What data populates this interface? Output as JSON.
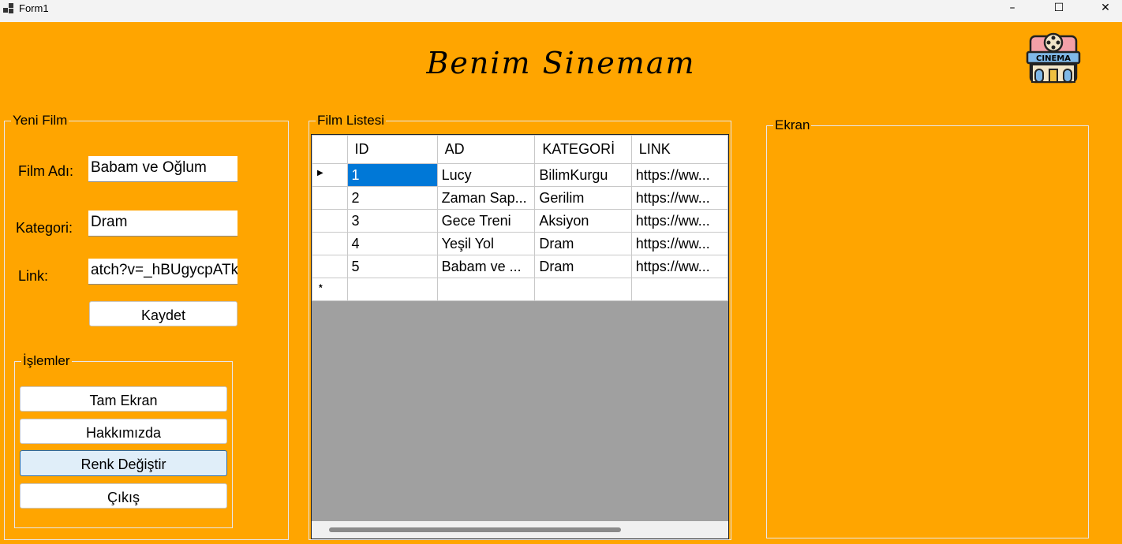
{
  "window": {
    "title": "Form1",
    "controls": {
      "minimize": "–",
      "maximize": "☐",
      "close": "✕"
    }
  },
  "app": {
    "title": "Benim Sinemam",
    "logo_text": "CINEMA"
  },
  "new_film": {
    "legend": "Yeni Film",
    "name_label": "Film Adı:",
    "name_value": "Babam ve Oğlum",
    "category_label": "Kategori:",
    "category_value": "Dram",
    "link_label": "Link:",
    "link_value": "atch?v=_hBUgycpATk",
    "save_label": "Kaydet"
  },
  "operations": {
    "legend": "İşlemler",
    "fullscreen_label": "Tam Ekran",
    "about_label": "Hakkımızda",
    "color_label": "Renk Değiştir",
    "exit_label": "Çıkış"
  },
  "film_list": {
    "legend": "Film Listesi",
    "columns": [
      "ID",
      "AD",
      "KATEGORİ",
      "LINK"
    ],
    "rows": [
      [
        "1",
        "Lucy",
        "BilimKurgu",
        "https://ww..."
      ],
      [
        "2",
        "Zaman Sap...",
        "Gerilim",
        "https://ww..."
      ],
      [
        "3",
        "Gece Treni",
        "Aksiyon",
        "https://ww..."
      ],
      [
        "4",
        "Yeşil Yol",
        "Dram",
        "https://ww..."
      ],
      [
        "5",
        "Babam ve ...",
        "Dram",
        "https://ww..."
      ]
    ],
    "current_row_marker": "▶",
    "new_row_marker": "*"
  },
  "screen": {
    "legend": "Ekran"
  },
  "colors": {
    "background": "#ffa500",
    "selection": "#0078d7",
    "grid_empty": "#a0a0a0"
  }
}
